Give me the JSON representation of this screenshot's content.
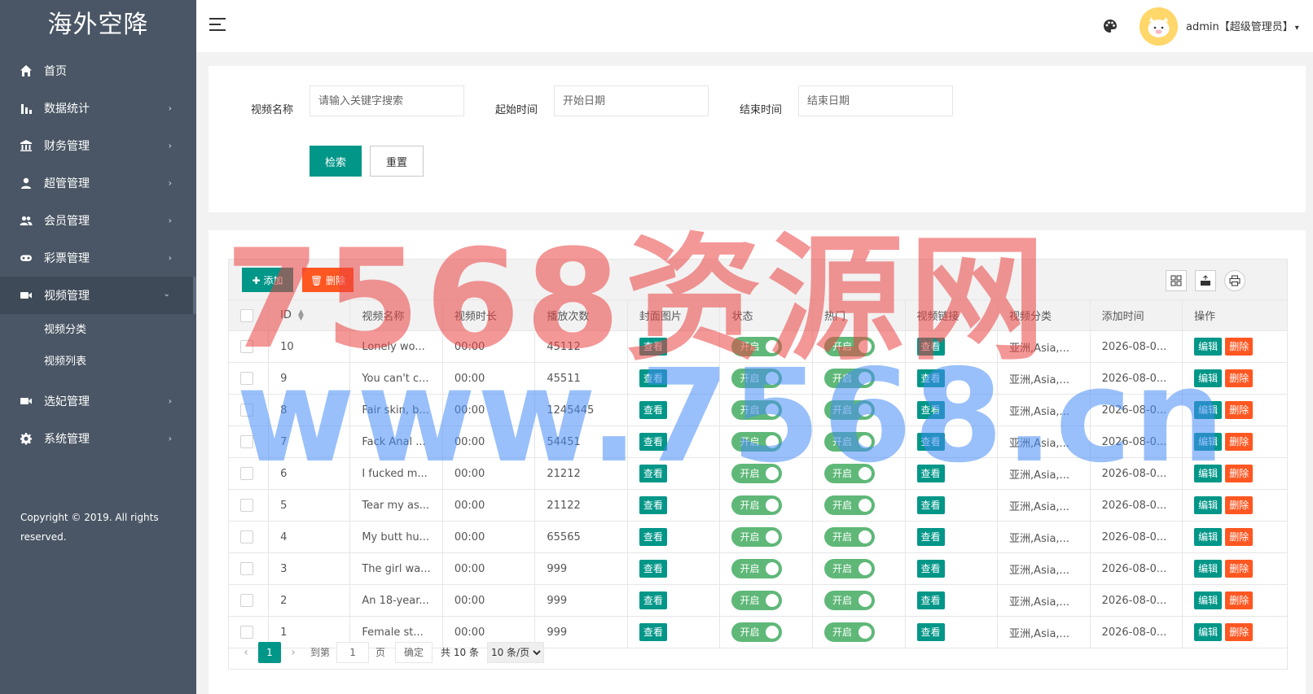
{
  "app": {
    "logo": "海外空降",
    "copyright": "Copyright © 2019. All rights reserved."
  },
  "sidebar": {
    "items": [
      {
        "label": "首页",
        "icon": "home-icon",
        "arrow": ""
      },
      {
        "label": "数据统计",
        "icon": "bar-chart-icon",
        "arrow": "›"
      },
      {
        "label": "财务管理",
        "icon": "bank-icon",
        "arrow": "›"
      },
      {
        "label": "超管管理",
        "icon": "user-icon",
        "arrow": "›"
      },
      {
        "label": "会员管理",
        "icon": "users-icon",
        "arrow": "›"
      },
      {
        "label": "彩票管理",
        "icon": "gamepad-icon",
        "arrow": "›"
      },
      {
        "label": "视频管理",
        "icon": "video-icon",
        "arrow": "›"
      },
      {
        "label": "选妃管理",
        "icon": "video-icon",
        "arrow": "›"
      },
      {
        "label": "系统管理",
        "icon": "gear-icon",
        "arrow": "›"
      }
    ],
    "submenu": [
      "视频分类",
      "视频列表"
    ]
  },
  "header": {
    "user": "admin【超级管理员】",
    "caret": "▾"
  },
  "search": {
    "name_label": "视频名称",
    "name_placeholder": "请输入关键字搜索",
    "start_label": "起始时间",
    "start_placeholder": "开始日期",
    "end_label": "结束时间",
    "end_placeholder": "结束日期",
    "search_btn": "检索",
    "reset_btn": "重置"
  },
  "toolbar": {
    "add_label": "添加",
    "delete_label": "删除"
  },
  "table": {
    "columns": [
      "ID",
      "视频名称",
      "视频时长",
      "播放次数",
      "封面图片",
      "状态",
      "热门",
      "视频链接",
      "视频分类",
      "添加时间",
      "操作"
    ],
    "view_label": "查看",
    "switch_label": "开启",
    "edit_label": "编辑",
    "delete_label": "删除",
    "rows": [
      {
        "id": "10",
        "name": "Lonely wo...",
        "duration": "00:00",
        "plays": "45112",
        "category": "亚洲,Asia,...",
        "added": "2026-08-0..."
      },
      {
        "id": "9",
        "name": "You can't c...",
        "duration": "00:00",
        "plays": "45511",
        "category": "亚洲,Asia,...",
        "added": "2026-08-0..."
      },
      {
        "id": "8",
        "name": "Fair skin, b...",
        "duration": "00:00",
        "plays": "1245445",
        "category": "亚洲,Asia,...",
        "added": "2026-08-0..."
      },
      {
        "id": "7",
        "name": "Fack Anal ...",
        "duration": "00:00",
        "plays": "54451",
        "category": "亚洲,Asia,...",
        "added": "2026-08-0..."
      },
      {
        "id": "6",
        "name": "I fucked m...",
        "duration": "00:00",
        "plays": "21212",
        "category": "亚洲,Asia,...",
        "added": "2026-08-0..."
      },
      {
        "id": "5",
        "name": "Tear my as...",
        "duration": "00:00",
        "plays": "21122",
        "category": "亚洲,Asia,...",
        "added": "2026-08-0..."
      },
      {
        "id": "4",
        "name": "My butt hu...",
        "duration": "00:00",
        "plays": "65565",
        "category": "亚洲,Asia,...",
        "added": "2026-08-0..."
      },
      {
        "id": "3",
        "name": "The girl wa...",
        "duration": "00:00",
        "plays": "999",
        "category": "亚洲,Asia,...",
        "added": "2026-08-0..."
      },
      {
        "id": "2",
        "name": "An 18-year...",
        "duration": "00:00",
        "plays": "999",
        "category": "亚洲,Asia,...",
        "added": "2026-08-0..."
      },
      {
        "id": "1",
        "name": "Female st...",
        "duration": "00:00",
        "plays": "999",
        "category": "亚洲,Asia,...",
        "added": "2026-08-0..."
      }
    ]
  },
  "pager": {
    "prev": "‹",
    "current": "1",
    "next": "›",
    "goto_label": "到第",
    "goto_value": "1",
    "page_label": "页",
    "ok_label": "确定",
    "total": "共 10 条",
    "size": "10 条/页"
  },
  "watermark": {
    "line1": "7568资源网",
    "line2": "www.7568.cn"
  },
  "colors": {
    "primary": "#009688",
    "danger": "#ff5722",
    "switch_on": "#5fb878",
    "sidebar": "#4a5665"
  }
}
